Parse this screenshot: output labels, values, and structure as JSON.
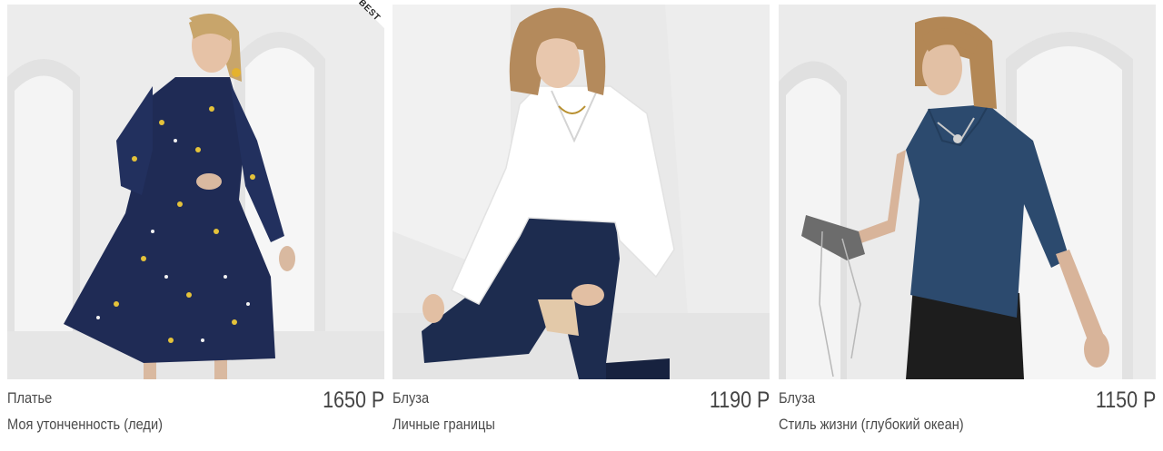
{
  "products": [
    {
      "type": "Платье",
      "name": "Моя утонченность (леди)",
      "price": "1650 Р",
      "badge": "BEST",
      "image": {
        "subject": "woman-in-navy-floral-midi-dress",
        "background": "#ececec",
        "garment_color": "#1f2b55"
      }
    },
    {
      "type": "Блуза",
      "name": "Личные границы",
      "price": "1190 Р",
      "image": {
        "subject": "woman-in-white-blouse-and-jeans",
        "background": "#e9e9e9",
        "garment_color": "#ffffff"
      }
    },
    {
      "type": "Блуза",
      "name": "Стиль жизни (глубокий океан)",
      "price": "1150 Р",
      "image": {
        "subject": "woman-in-navy-blouse-with-clutch",
        "background": "#ebebeb",
        "garment_color": "#2c4a6e"
      }
    }
  ]
}
